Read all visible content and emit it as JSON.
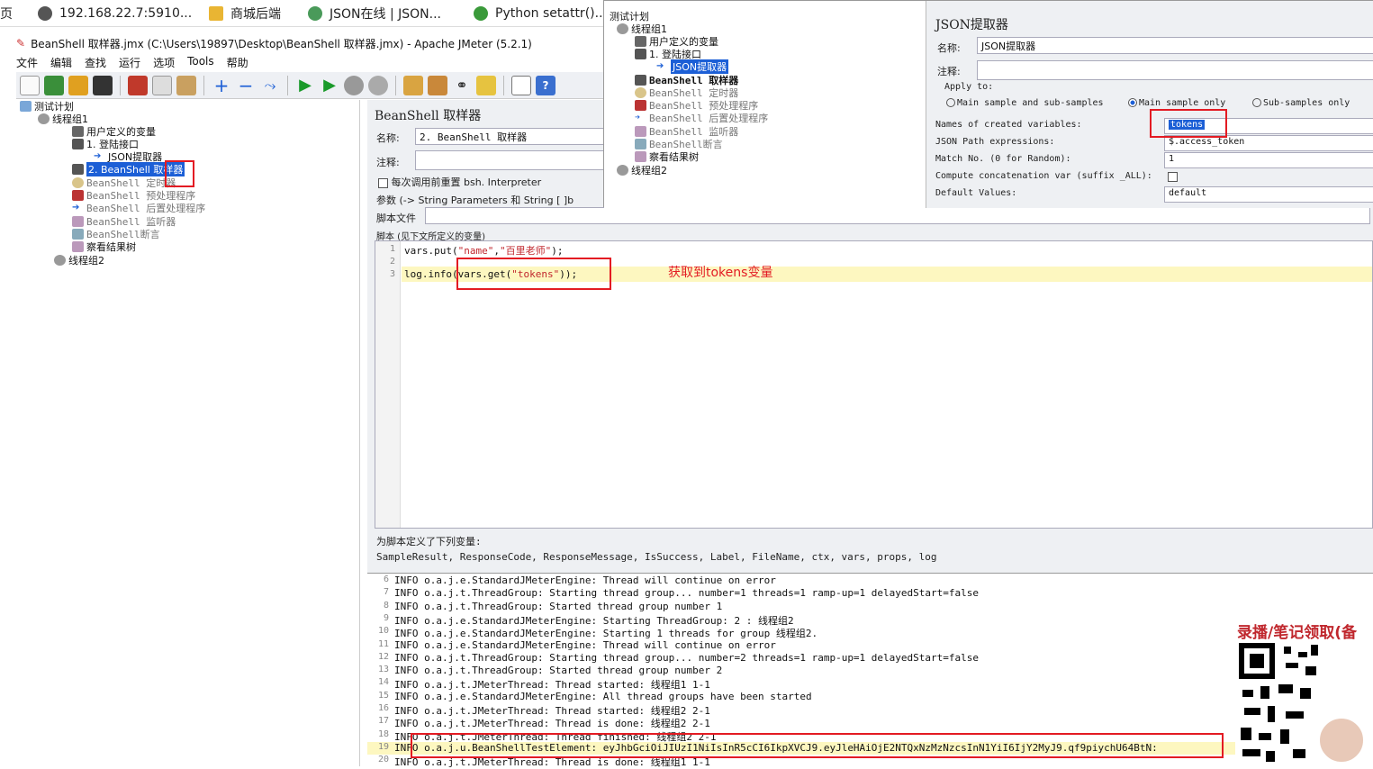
{
  "browser_tabs": [
    {
      "label": "页",
      "icon": "none"
    },
    {
      "label": "192.168.22.7:5910...",
      "icon": "globe-icon"
    },
    {
      "label": "商城后端",
      "icon": "app-icon"
    },
    {
      "label": "JSON在线 | JSON...",
      "icon": "gear-icon"
    },
    {
      "label": "Python setattr()...",
      "icon": "code-icon"
    }
  ],
  "window": {
    "title": "BeanShell 取样器.jmx (C:\\Users\\19897\\Desktop\\BeanShell 取样器.jmx) - Apache JMeter (5.2.1)"
  },
  "menu": [
    "文件",
    "编辑",
    "查找",
    "运行",
    "选项",
    "Tools",
    "帮助"
  ],
  "tree": [
    {
      "label": "测试计划",
      "style": "normal"
    },
    {
      "label": "线程组1",
      "style": "normal"
    },
    {
      "label": "用户定义的变量",
      "style": "normal"
    },
    {
      "label": "1. 登陆接口",
      "style": "normal"
    },
    {
      "label": "JSON提取器",
      "style": "normal"
    },
    {
      "label": "2. BeanShell 取样器",
      "style": "selected"
    },
    {
      "label": "BeanShell 定时器",
      "style": "gray"
    },
    {
      "label": "BeanShell 预处理程序",
      "style": "gray"
    },
    {
      "label": "BeanShell 后置处理程序",
      "style": "gray"
    },
    {
      "label": "BeanShell 监听器",
      "style": "gray"
    },
    {
      "label": "BeanShell断言",
      "style": "gray"
    },
    {
      "label": "察看结果树",
      "style": "normal"
    },
    {
      "label": "线程组2",
      "style": "normal"
    }
  ],
  "sampler": {
    "heading": "BeanShell 取样器",
    "name_label": "名称:",
    "name_value": "2. BeanShell 取样器",
    "comment_label": "注释:",
    "reset_label": "每次调用前重置 bsh. Interpreter",
    "params_label": "参数 (-> String Parameters 和 String [ ]b",
    "script_file_label": "脚本文件",
    "script_label": "脚本 (见下文所定义的变量)",
    "script_lines": [
      {
        "no": "1",
        "code": "vars.put(\"name\",\"百里老师\");"
      },
      {
        "no": "2",
        "code": ""
      },
      {
        "no": "3",
        "code": "log.info(vars.get(\"tokens\"));"
      }
    ],
    "vars_title": "为脚本定义了下列变量:",
    "vars_list": "SampleResult, ResponseCode, ResponseMessage, IsSuccess, Label, FileName, ctx, vars, props, log"
  },
  "annotation": "获取到tokens变量",
  "log_lines": [
    {
      "no": "6",
      "text": "INFO o.a.j.e.StandardJMeterEngine: Thread will continue on error"
    },
    {
      "no": "7",
      "text": "INFO o.a.j.t.ThreadGroup: Starting thread group... number=1 threads=1 ramp-up=1 delayedStart=false"
    },
    {
      "no": "8",
      "text": "INFO o.a.j.t.ThreadGroup: Started thread group number 1"
    },
    {
      "no": "9",
      "text": "INFO o.a.j.e.StandardJMeterEngine: Starting ThreadGroup: 2 : 线程组2"
    },
    {
      "no": "10",
      "text": "INFO o.a.j.e.StandardJMeterEngine: Starting 1 threads for group 线程组2."
    },
    {
      "no": "11",
      "text": "INFO o.a.j.e.StandardJMeterEngine: Thread will continue on error"
    },
    {
      "no": "12",
      "text": "INFO o.a.j.t.ThreadGroup: Starting thread group... number=2 threads=1 ramp-up=1 delayedStart=false"
    },
    {
      "no": "13",
      "text": "INFO o.a.j.t.ThreadGroup: Started thread group number 2"
    },
    {
      "no": "14",
      "text": "INFO o.a.j.t.JMeterThread: Thread started: 线程组1 1-1"
    },
    {
      "no": "15",
      "text": "INFO o.a.j.e.StandardJMeterEngine: All thread groups have been started"
    },
    {
      "no": "16",
      "text": "INFO o.a.j.t.JMeterThread: Thread started: 线程组2 2-1"
    },
    {
      "no": "17",
      "text": "INFO o.a.j.t.JMeterThread: Thread is done: 线程组2 2-1"
    },
    {
      "no": "18",
      "text": "INFO o.a.j.t.JMeterThread: Thread finished: 线程组2 2-1"
    },
    {
      "no": "19",
      "text": "INFO o.a.j.u.BeanShellTestElement: eyJhbGciOiJIUzI1NiIsInR5cCI6IkpXVCJ9.eyJleHAiOjE2NTQxNzMzNzcsInN1YiI6IjY2MyJ9.qf9piychU64BtN:"
    },
    {
      "no": "20",
      "text": "INFO o.a.j.t.JMeterThread: Thread is done: 线程组1 1-1"
    }
  ],
  "overlay_tree": [
    {
      "label": "测试计划",
      "style": "normal"
    },
    {
      "label": "线程组1",
      "style": "normal"
    },
    {
      "label": "用户定义的变量",
      "style": "normal"
    },
    {
      "label": "1. 登陆接口",
      "style": "normal"
    },
    {
      "label": "JSON提取器",
      "style": "selected"
    },
    {
      "label": "BeanShell 取样器",
      "style": "normal"
    },
    {
      "label": "BeanShell 定时器",
      "style": "gray"
    },
    {
      "label": "BeanShell 预处理程序",
      "style": "gray"
    },
    {
      "label": "BeanShell 后置处理程序",
      "style": "gray"
    },
    {
      "label": "BeanShell 监听器",
      "style": "gray"
    },
    {
      "label": "BeanShell断言",
      "style": "gray"
    },
    {
      "label": "察看结果树",
      "style": "normal"
    },
    {
      "label": "线程组2",
      "style": "normal"
    }
  ],
  "json_extractor": {
    "heading": "JSON提取器",
    "name_label": "名称:",
    "name_value": "JSON提取器",
    "comment_label": "注释:",
    "apply_to": "Apply to:",
    "opt_main_sub": "Main sample and sub-samples",
    "opt_main_only": "Main sample only",
    "opt_sub_only": "Sub-samples only",
    "names_label": "Names of created variables:",
    "names_value": "tokens",
    "path_label": "JSON Path expressions:",
    "path_value": "$.access_token",
    "match_label": "Match No. (0 for Random):",
    "match_value": "1",
    "concat_label": "Compute concatenation var (suffix _ALL):",
    "default_label": "Default Values:",
    "default_value": "default"
  },
  "promo": {
    "text": "录播/笔记领取(备"
  },
  "colors": {
    "accent": "#1c5fd6",
    "annotation": "#e31b23",
    "highlight": "#fdf7c0"
  }
}
